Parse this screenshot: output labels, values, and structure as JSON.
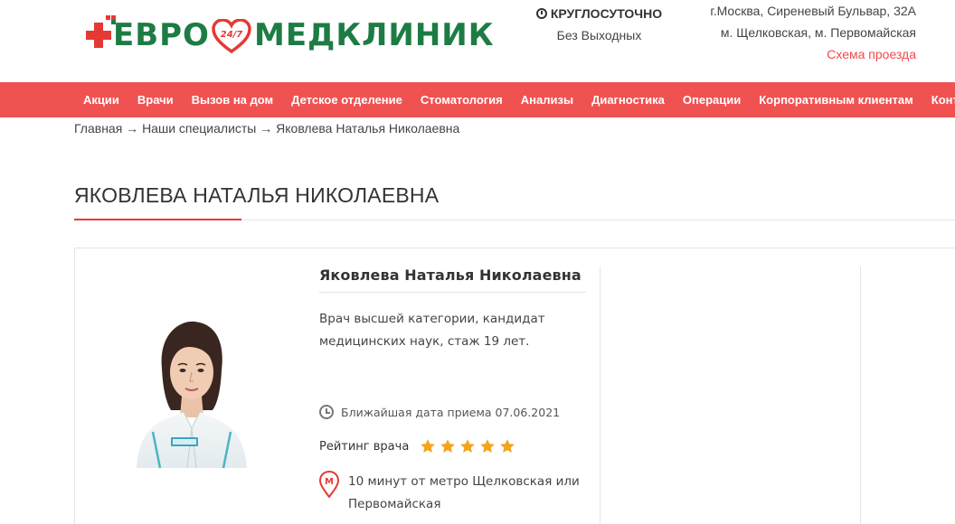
{
  "header": {
    "logo_text_left": "ЕВРО",
    "logo_heart_text": "24/7",
    "logo_text_right": "МЕДКЛИНИК",
    "hours_title": "КРУГЛОСУТОЧНО",
    "hours_sub": "Без Выходных",
    "address_line1": "г.Москва, Сиреневый Бульвар, 32А",
    "address_line2": "м. Щелковская, м. Первомайская",
    "map_link": "Схема проезда"
  },
  "nav": {
    "items": [
      "Акции",
      "Врачи",
      "Вызов на дом",
      "Детское отделение",
      "Стоматология",
      "Анализы",
      "Диагностика",
      "Операции",
      "Корпоративным клиентам",
      "Контакты"
    ]
  },
  "breadcrumb": "Главная → Наши специалисты → Яковлева Наталья Николаевна",
  "page_title": "ЯКОВЛЕВА НАТАЛЬЯ НИКОЛАЕВНА",
  "doctor": {
    "name": "Яковлева Наталья Николаевна",
    "description": "Врач высшей категории, кандидат медицинских наук, стаж 19 лет.",
    "next_date": "Ближайшая дата приема 07.06.2021",
    "rating_label": "Рейтинг врача",
    "rating_value": 5,
    "rating_max": 5,
    "metro": "10 минут от метро Щелковская или Первомайская"
  },
  "colors": {
    "brand_green": "#1d7c44",
    "accent_red": "#f05252",
    "star_gold": "#f2a41c"
  }
}
